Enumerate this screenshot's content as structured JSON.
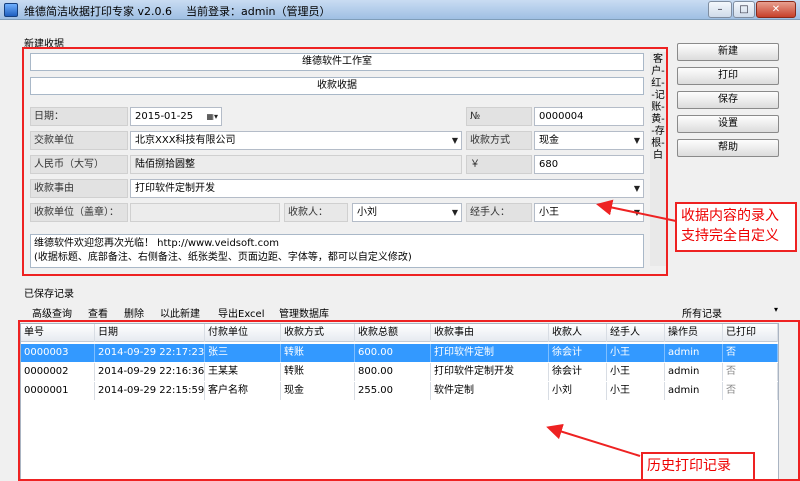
{
  "window": {
    "title": "维德简洁收据打印专家 v2.0.6",
    "login": "当前登录：admin（管理员）",
    "min_glyph": "–",
    "max_glyph": "□",
    "close_glyph": "✕"
  },
  "sections": {
    "new_receipt": "新建收据",
    "saved_records": "已保存记录"
  },
  "form": {
    "company_name": "维德软件工作室",
    "receipt_title": "收款收据",
    "date_label": "日期：",
    "date_value": "2015-01-25",
    "no_label": "№",
    "no_value": "0000004",
    "payer_label": "交款单位",
    "payer_value": "北京XXX科技有限公司",
    "pay_method_label": "收款方式",
    "pay_method_value": "现金",
    "rmb_label": "人民币（大写）",
    "rmb_value": "陆佰捌拾圆整",
    "yen_label": "￥",
    "amount_value": "680",
    "reason_label": "收款事由",
    "reason_value": "打印软件定制开发",
    "payee_unit_label": "收款单位（盖章）：",
    "receiver_label": "收款人：",
    "receiver_value": "小刘",
    "handler_label": "经手人：",
    "handler_value": "小王",
    "memo_line1": "维德软件欢迎您再次光临！  http://www.veidsoft.com",
    "memo_line2": "(收据标题、底部备注、右侧备注、纸张类型、页面边距、字体等，都可以自定义修改)",
    "side_text": "客户-红--记账-黄--存根-白"
  },
  "buttons": {
    "new": "新建",
    "print": "打印",
    "save": "保存",
    "settings": "设置",
    "help": "帮助"
  },
  "callouts": {
    "form_note": "收据内容的录入\n支持完全自定义",
    "history_note": "历史打印记录"
  },
  "toolbar": {
    "advanced_search": "高级查询",
    "view": "查看",
    "delete": "删除",
    "new_from": "以此新建",
    "export_excel": "导出Excel",
    "manage_db": "管理数据库",
    "filter_value": "所有记录"
  },
  "table": {
    "headers": [
      "单号",
      "日期",
      "付款单位",
      "收款方式",
      "收款总额",
      "收款事由",
      "收款人",
      "经手人",
      "操作员",
      "已打印"
    ],
    "rows": [
      [
        "0000003",
        "2014-09-29 22:17:23",
        "张三",
        "转账",
        "600.00",
        "打印软件定制",
        "徐会计",
        "小王",
        "admin",
        "否"
      ],
      [
        "0000002",
        "2014-09-29 22:16:36",
        "王某某",
        "转账",
        "800.00",
        "打印软件定制开发",
        "徐会计",
        "小王",
        "admin",
        "否"
      ],
      [
        "0000001",
        "2014-09-29 22:15:59",
        "客户名称",
        "现金",
        "255.00",
        "软件定制",
        "小刘",
        "小王",
        "admin",
        "否"
      ]
    ]
  },
  "colors": {
    "accent_red": "#ee2222",
    "selection_blue": "#3399ff"
  },
  "icons": {
    "calendar": "calendar-icon",
    "dropdown": "chevron-down-icon"
  }
}
